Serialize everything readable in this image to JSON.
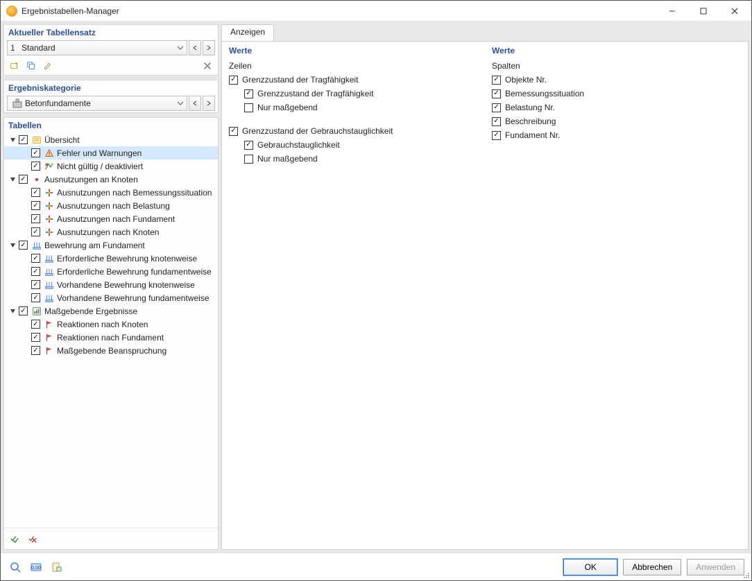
{
  "window": {
    "title": "Ergebnistabellen-Manager"
  },
  "left": {
    "tablesat_title": "Aktueller Tabellensatz",
    "tablesat_num": "1",
    "tablesat_value": "Standard",
    "category_title": "Ergebniskategorie",
    "category_value": "Betonfundamente",
    "tables_title": "Tabellen"
  },
  "tree": [
    {
      "depth": 0,
      "exp": true,
      "chk": true,
      "icon": "overview",
      "label": "Übersicht"
    },
    {
      "depth": 1,
      "exp": null,
      "chk": true,
      "icon": "warn",
      "label": "Fehler und Warnungen",
      "selected": true
    },
    {
      "depth": 1,
      "exp": null,
      "chk": true,
      "icon": "invalid",
      "label": "Nicht gültig / deaktiviert"
    },
    {
      "depth": 0,
      "exp": true,
      "chk": true,
      "icon": "dot-red",
      "label": "Ausnutzungen an Knoten"
    },
    {
      "depth": 1,
      "exp": null,
      "chk": true,
      "icon": "cross",
      "label": "Ausnutzungen nach Bemessungssituation"
    },
    {
      "depth": 1,
      "exp": null,
      "chk": true,
      "icon": "cross",
      "label": "Ausnutzungen nach Belastung"
    },
    {
      "depth": 1,
      "exp": null,
      "chk": true,
      "icon": "cross",
      "label": "Ausnutzungen nach Fundament"
    },
    {
      "depth": 1,
      "exp": null,
      "chk": true,
      "icon": "cross",
      "label": "Ausnutzungen nach Knoten"
    },
    {
      "depth": 0,
      "exp": true,
      "chk": true,
      "icon": "rebar-blue",
      "label": "Bewehrung am Fundament"
    },
    {
      "depth": 1,
      "exp": null,
      "chk": true,
      "icon": "rebar-blue",
      "label": "Erforderliche Bewehrung knotenweise"
    },
    {
      "depth": 1,
      "exp": null,
      "chk": true,
      "icon": "rebar-blue",
      "label": "Erforderliche Bewehrung fundamentweise"
    },
    {
      "depth": 1,
      "exp": null,
      "chk": true,
      "icon": "rebar-blue",
      "label": "Vorhandene Bewehrung knotenweise"
    },
    {
      "depth": 1,
      "exp": null,
      "chk": true,
      "icon": "rebar-blue",
      "label": "Vorhandene Bewehrung fundamentweise"
    },
    {
      "depth": 0,
      "exp": true,
      "chk": true,
      "icon": "result",
      "label": "Maßgebende Ergebnisse"
    },
    {
      "depth": 1,
      "exp": null,
      "chk": true,
      "icon": "flag",
      "label": "Reaktionen nach Knoten"
    },
    {
      "depth": 1,
      "exp": null,
      "chk": true,
      "icon": "flag",
      "label": "Reaktionen nach Fundament"
    },
    {
      "depth": 1,
      "exp": null,
      "chk": true,
      "icon": "flag",
      "label": "Maßgebende Beanspruchung"
    }
  ],
  "right": {
    "tab": "Anzeigen",
    "col1_title": "Werte",
    "col1_sub": "Zeilen",
    "col2_title": "Werte",
    "col2_sub": "Spalten"
  },
  "rows_groups": [
    {
      "label": "Grenzzustand der Tragfähigkeit",
      "chk": true,
      "children": [
        {
          "label": "Grenzzustand der Tragfähigkeit",
          "chk": true
        },
        {
          "label": "Nur maßgebend",
          "chk": false
        }
      ]
    },
    {
      "label": "Grenzzustand der Gebrauchstauglichkeit",
      "chk": true,
      "children": [
        {
          "label": "Gebrauchstauglichkeit",
          "chk": true
        },
        {
          "label": "Nur maßgebend",
          "chk": false
        }
      ]
    }
  ],
  "cols_opts": [
    {
      "label": "Objekte Nr.",
      "chk": true
    },
    {
      "label": "Bemessungssituation",
      "chk": true
    },
    {
      "label": "Belastung Nr.",
      "chk": true
    },
    {
      "label": "Beschreibung",
      "chk": true
    },
    {
      "label": "Fundament Nr.",
      "chk": true
    }
  ],
  "footer": {
    "ok": "OK",
    "cancel": "Abbrechen",
    "apply": "Anwenden"
  }
}
